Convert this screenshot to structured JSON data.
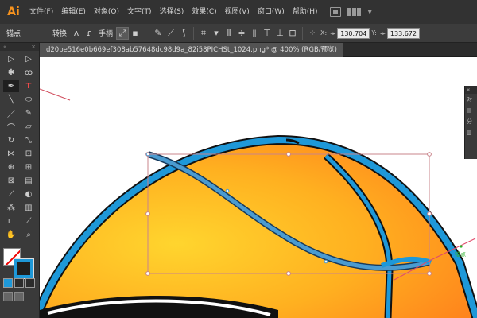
{
  "app": {
    "logo": "Ai"
  },
  "menu": [
    {
      "label": "文件(F)"
    },
    {
      "label": "编辑(E)"
    },
    {
      "label": "对象(O)"
    },
    {
      "label": "文字(T)"
    },
    {
      "label": "选择(S)"
    },
    {
      "label": "效果(C)"
    },
    {
      "label": "视图(V)"
    },
    {
      "label": "窗口(W)"
    },
    {
      "label": "帮助(H)"
    }
  ],
  "control_bar": {
    "context_label": "锚点",
    "convert_label": "转换",
    "handles_label": "手柄",
    "x_label": "X:",
    "x_value": "130.704",
    "y_label": "Y:",
    "y_value": "133.672"
  },
  "document": {
    "tab_title": "d20be516e0b669ef308ab57648dc98d9a_82i58PICHSt_1024.png*  @  400%  (RGB/预览)"
  },
  "canvas": {
    "smart_guide_label": "锚点",
    "colors": {
      "ball_center": "#ffd52e",
      "ball_edge": "#ff8a1c",
      "seam_blue": "#1e98d8",
      "seam_dark": "#111111",
      "bbox": "#c9848b"
    }
  },
  "tools": [
    {
      "icon": "selection-icon",
      "glyph": "▷"
    },
    {
      "icon": "direct-selection-icon",
      "glyph": "▷"
    },
    {
      "icon": "magic-wand-icon",
      "glyph": "✱"
    },
    {
      "icon": "lasso-icon",
      "glyph": "ꝏ"
    },
    {
      "icon": "pen-icon",
      "glyph": "✒"
    },
    {
      "icon": "type-icon",
      "glyph": "T"
    },
    {
      "icon": "line-icon",
      "glyph": "╲"
    },
    {
      "icon": "ellipse-icon",
      "glyph": "⬭"
    },
    {
      "icon": "paintbrush-icon",
      "glyph": "／"
    },
    {
      "icon": "pencil-icon",
      "glyph": "✎"
    },
    {
      "icon": "blob-brush-icon",
      "glyph": "⌒"
    },
    {
      "icon": "eraser-icon",
      "glyph": "▱"
    },
    {
      "icon": "rotate-icon",
      "glyph": "↻"
    },
    {
      "icon": "scale-icon",
      "glyph": "⤡"
    },
    {
      "icon": "width-icon",
      "glyph": "⋈"
    },
    {
      "icon": "free-transform-icon",
      "glyph": "⊡"
    },
    {
      "icon": "shape-builder-icon",
      "glyph": "⊕"
    },
    {
      "icon": "perspective-grid-icon",
      "glyph": "⊞"
    },
    {
      "icon": "mesh-icon",
      "glyph": "⊠"
    },
    {
      "icon": "gradient-icon",
      "glyph": "▤"
    },
    {
      "icon": "eyedropper-icon",
      "glyph": "⟋"
    },
    {
      "icon": "blend-icon",
      "glyph": "◐"
    },
    {
      "icon": "symbol-sprayer-icon",
      "glyph": "⁂"
    },
    {
      "icon": "column-graph-icon",
      "glyph": "▥"
    },
    {
      "icon": "artboard-icon",
      "glyph": "⊏"
    },
    {
      "icon": "slice-icon",
      "glyph": "⟋"
    },
    {
      "icon": "hand-icon",
      "glyph": "✋"
    },
    {
      "icon": "zoom-icon",
      "glyph": "⌕"
    }
  ],
  "side_panel": {
    "rows": [
      "对",
      "分"
    ]
  }
}
